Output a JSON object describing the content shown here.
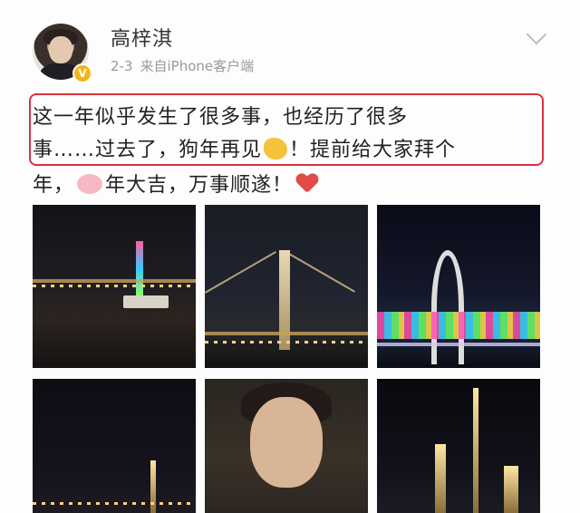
{
  "post": {
    "username": "高梓淇",
    "time": "2-3",
    "source": "来自iPhone客户端",
    "verified_badge": "V",
    "text_lines": [
      "这一年似乎发生了很多事，也经历了很多",
      "事……过去了，狗年再见",
      "！提前给大家拜个",
      "年，",
      "年大吉，万事顺遂！"
    ],
    "icons": {
      "wave": "waving-hand-emoji",
      "pig": "pig-face-emoji",
      "heart": "red-heart-emoji",
      "menu": "chevron-down-icon"
    },
    "highlight_color": "#d9323c",
    "badge_color": "#f2b51c"
  }
}
